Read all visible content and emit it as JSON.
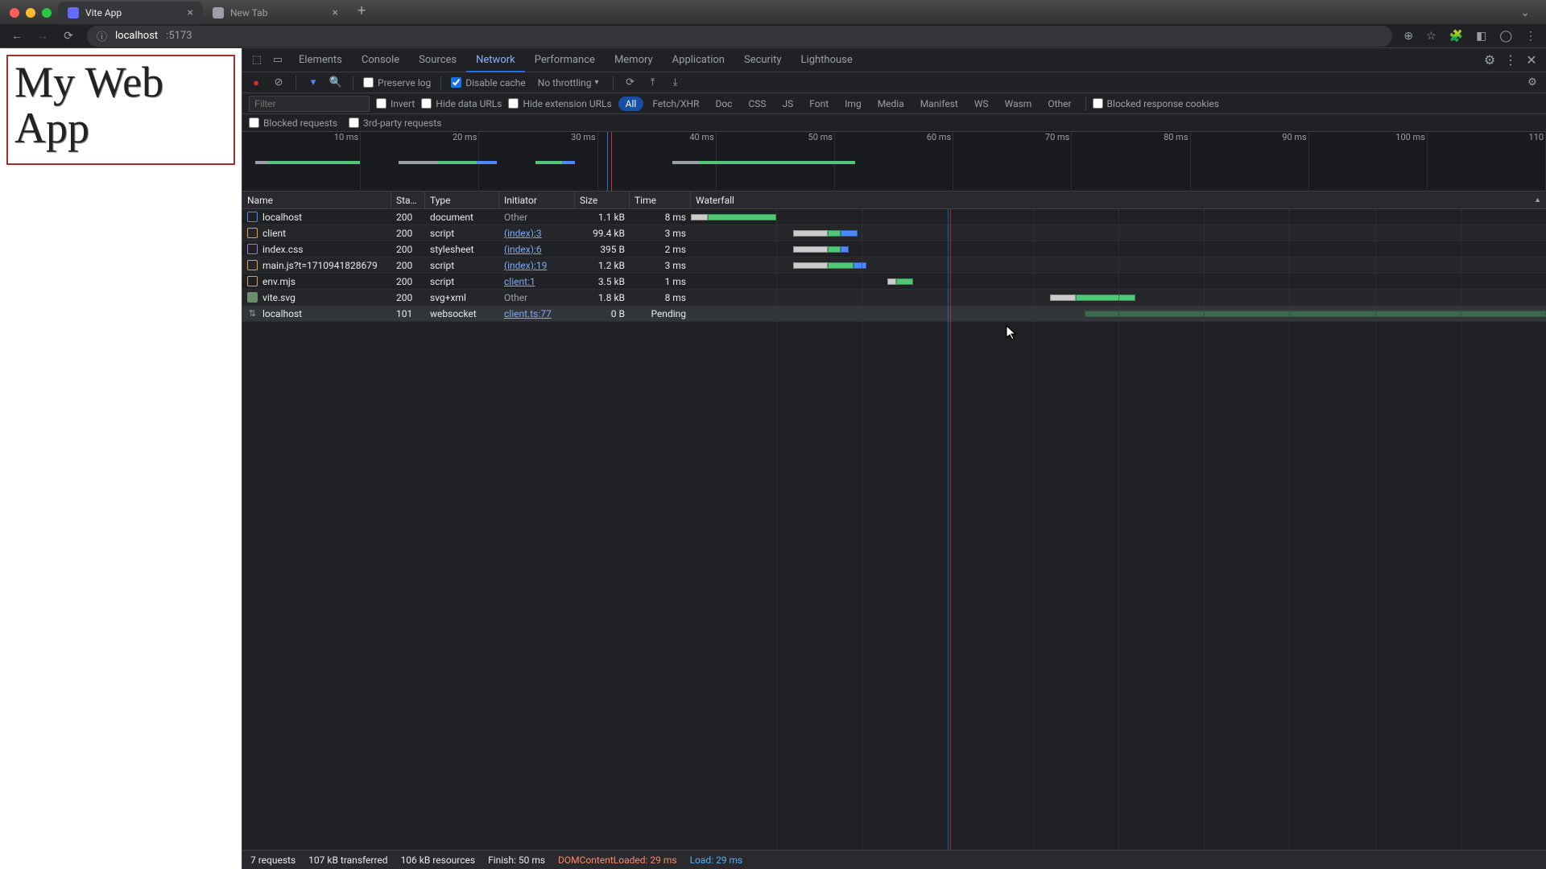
{
  "browser": {
    "tabs": [
      {
        "title": "Vite App",
        "active": true,
        "favicon_color": "#646cff"
      },
      {
        "title": "New Tab",
        "active": false,
        "favicon_color": "#9aa0a6"
      }
    ],
    "url_host": "localhost",
    "url_port": ":5173"
  },
  "page": {
    "heading": "My Web App"
  },
  "devtools": {
    "tabs": [
      "Elements",
      "Console",
      "Sources",
      "Network",
      "Performance",
      "Memory",
      "Application",
      "Security",
      "Lighthouse"
    ],
    "active_tab": "Network",
    "toolbar": {
      "preserve_log": "Preserve log",
      "preserve_log_checked": false,
      "disable_cache": "Disable cache",
      "disable_cache_checked": true,
      "throttling": "No throttling"
    },
    "filter": {
      "placeholder": "Filter",
      "invert": "Invert",
      "hide_data": "Hide data URLs",
      "hide_ext": "Hide extension URLs",
      "types": [
        "All",
        "Fetch/XHR",
        "Doc",
        "CSS",
        "JS",
        "Font",
        "Img",
        "Media",
        "Manifest",
        "WS",
        "Wasm",
        "Other"
      ],
      "active_type": "All",
      "blocked_cookies": "Blocked response cookies",
      "blocked_requests": "Blocked requests",
      "third_party": "3rd-party requests"
    },
    "overview_ticks": [
      "10 ms",
      "20 ms",
      "30 ms",
      "40 ms",
      "50 ms",
      "60 ms",
      "70 ms",
      "80 ms",
      "90 ms",
      "100 ms",
      "110"
    ],
    "columns": {
      "name": "Name",
      "status": "Stat…",
      "type": "Type",
      "initiator": "Initiator",
      "size": "Size",
      "time": "Time",
      "waterfall": "Waterfall"
    },
    "requests": [
      {
        "name": "localhost",
        "status": "200",
        "type": "document",
        "initiator": "Other",
        "initiator_link": false,
        "size": "1.1 kB",
        "time": "8 ms",
        "icon": "doc",
        "wf": [
          {
            "c": "lt",
            "l": 0,
            "w": 2
          },
          {
            "c": "grn",
            "l": 2,
            "w": 8
          }
        ]
      },
      {
        "name": "client",
        "status": "200",
        "type": "script",
        "initiator": "(index):3",
        "initiator_link": true,
        "size": "99.4 kB",
        "time": "3 ms",
        "icon": "js",
        "wf": [
          {
            "c": "lt",
            "l": 12,
            "w": 4
          },
          {
            "c": "grn",
            "l": 16,
            "w": 1.5
          },
          {
            "c": "blu",
            "l": 17.5,
            "w": 2
          }
        ]
      },
      {
        "name": "index.css",
        "status": "200",
        "type": "stylesheet",
        "initiator": "(index):6",
        "initiator_link": true,
        "size": "395 B",
        "time": "2 ms",
        "icon": "css",
        "wf": [
          {
            "c": "lt",
            "l": 12,
            "w": 4
          },
          {
            "c": "grn",
            "l": 16,
            "w": 1.5
          },
          {
            "c": "blu",
            "l": 17.5,
            "w": 1
          }
        ]
      },
      {
        "name": "main.js?t=1710941828679",
        "status": "200",
        "type": "script",
        "initiator": "(index):19",
        "initiator_link": true,
        "size": "1.2 kB",
        "time": "3 ms",
        "icon": "js",
        "wf": [
          {
            "c": "lt",
            "l": 12,
            "w": 4
          },
          {
            "c": "grn",
            "l": 16,
            "w": 3
          },
          {
            "c": "blu",
            "l": 19,
            "w": 1.5
          }
        ]
      },
      {
        "name": "env.mjs",
        "status": "200",
        "type": "script",
        "initiator": "client:1",
        "initiator_link": true,
        "size": "3.5 kB",
        "time": "1 ms",
        "icon": "js",
        "wf": [
          {
            "c": "lt",
            "l": 23,
            "w": 1
          },
          {
            "c": "grn",
            "l": 24,
            "w": 2
          }
        ]
      },
      {
        "name": "vite.svg",
        "status": "200",
        "type": "svg+xml",
        "initiator": "Other",
        "initiator_link": false,
        "size": "1.8 kB",
        "time": "8 ms",
        "icon": "svg",
        "wf": [
          {
            "c": "lt",
            "l": 42,
            "w": 3
          },
          {
            "c": "grn",
            "l": 45,
            "w": 7
          }
        ]
      },
      {
        "name": "localhost",
        "status": "101",
        "type": "websocket",
        "initiator": "client.ts:77",
        "initiator_link": true,
        "size": "0 B",
        "time": "Pending",
        "icon": "ws",
        "wf": [
          {
            "c": "grn",
            "l": 46,
            "w": 54
          }
        ],
        "hover": true,
        "wf_dim": true
      }
    ],
    "status": {
      "requests": "7 requests",
      "transferred": "107 kB transferred",
      "resources": "106 kB resources",
      "finish": "Finish: 50 ms",
      "dcl": "DOMContentLoaded: 29 ms",
      "load": "Load: 29 ms"
    }
  }
}
